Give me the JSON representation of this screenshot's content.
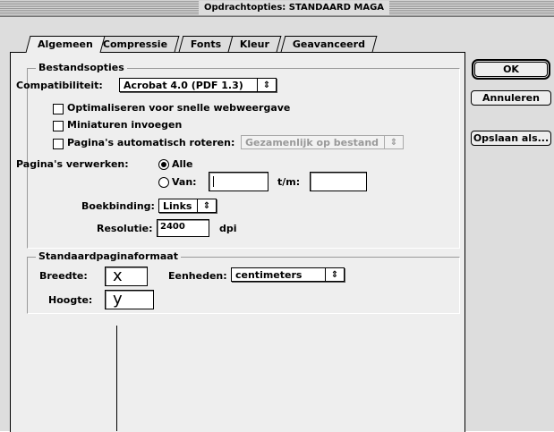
{
  "window": {
    "title": "Opdrachtopties: STANDAARD MAGA"
  },
  "tabs": [
    {
      "label": "Algemeen"
    },
    {
      "label": "Compressie"
    },
    {
      "label": "Fonts"
    },
    {
      "label": "Kleur"
    },
    {
      "label": "Geavanceerd"
    }
  ],
  "file_options": {
    "group_label": "Bestandsopties",
    "compat_label": "Compatibiliteit:",
    "compat_value": "Acrobat 4.0 (PDF 1.3)",
    "optimize_label": "Optimaliseren voor snelle webweergave",
    "thumbs_label": "Miniaturen invoegen",
    "rotate_label": "Pagina's automatisch roteren:",
    "rotate_value": "Gezamenlijk op bestand",
    "pages_label": "Pagina's verwerken:",
    "all_label": "Alle",
    "from_label": "Van:",
    "to_label": "t/m:",
    "binding_label": "Boekbinding:",
    "binding_value": "Links",
    "resolution_label": "Resolutie:",
    "resolution_value": "2400",
    "resolution_unit": "dpi"
  },
  "page_size": {
    "group_label": "Standaardpaginaformaat",
    "width_label": "Breedte:",
    "width_value": "x",
    "units_label": "Eenheden:",
    "units_value": "centimeters",
    "height_label": "Hoogte:",
    "height_value": "y"
  },
  "buttons": {
    "ok": "OK",
    "cancel": "Annuleren",
    "save_as": "Opslaan als..."
  },
  "icons": {
    "popup_arrows": "⇕"
  }
}
